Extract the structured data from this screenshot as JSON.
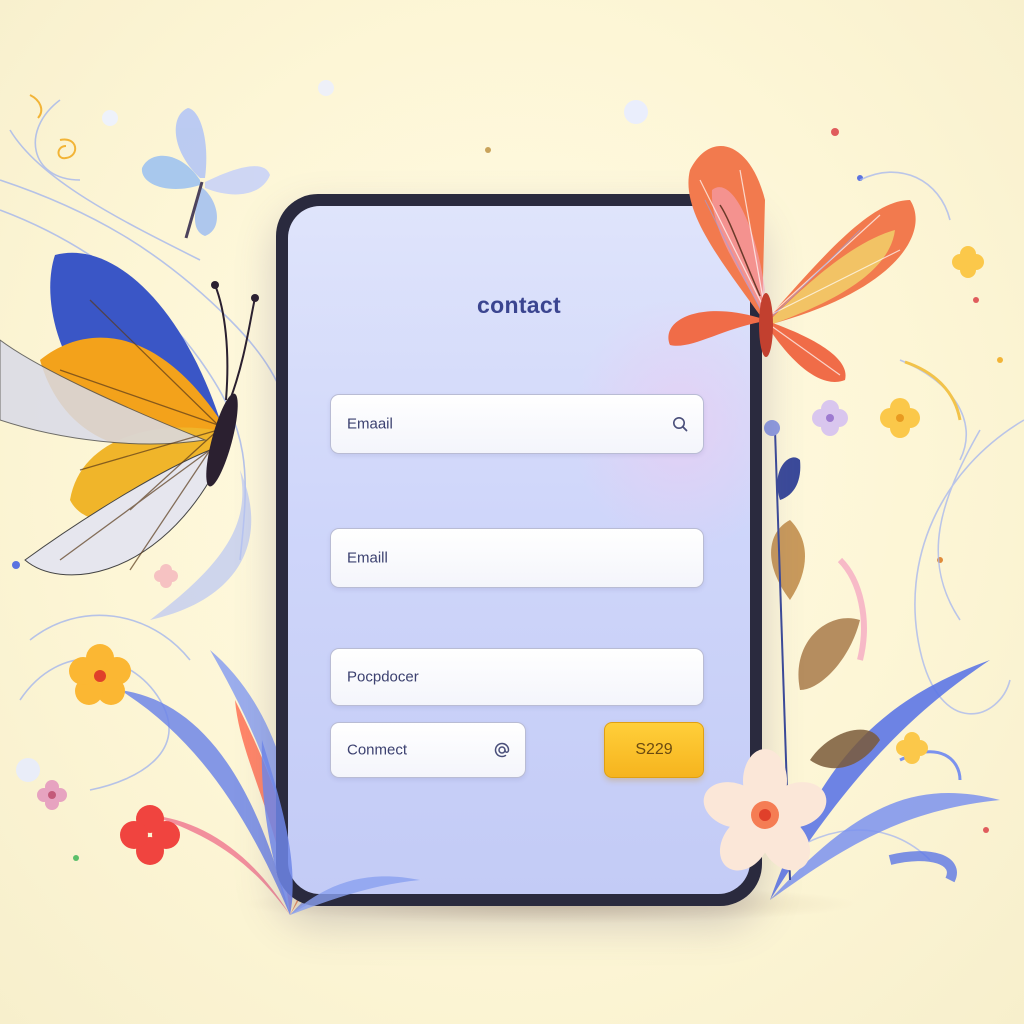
{
  "form": {
    "title": "contact",
    "fields": [
      {
        "value": "Emaail",
        "icon": "search-icon"
      },
      {
        "value": "Emaill"
      },
      {
        "value": "Pocpdocer"
      },
      {
        "value": "Conmect",
        "icon": "at-sign-icon"
      }
    ],
    "button_label": "S229"
  },
  "colors": {
    "background": "#fdf6d6",
    "screen": "#cfd6fa",
    "title": "#3b4590",
    "button": "#f6b41e"
  }
}
